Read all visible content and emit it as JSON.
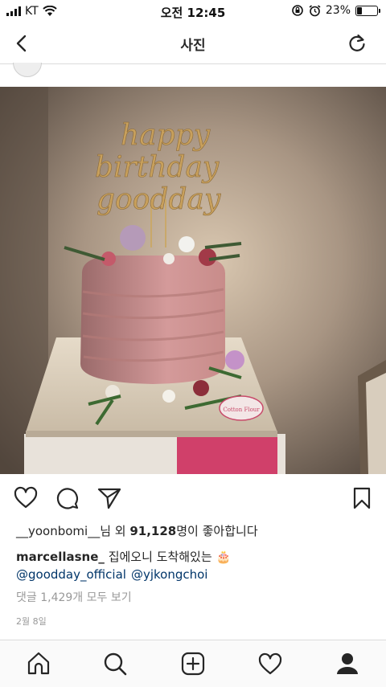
{
  "status_bar": {
    "carrier": "KT",
    "time": "오전 12:45",
    "battery_percent": "23%",
    "battery_level": 0.23
  },
  "nav": {
    "title": "사진",
    "back_icon": "chevron-left-icon",
    "refresh_icon": "refresh-icon"
  },
  "post": {
    "topper_line_1": "happy",
    "topper_line_2": "birthday",
    "topper_line_3": "goodday",
    "box_label": "Cotton Flour",
    "likes_user": "__yoonbomi__",
    "likes_prefix": "님 외 ",
    "likes_count": "91,128",
    "likes_suffix": "명이 좋아합니다",
    "caption_user": "marcellasne_",
    "caption_text": "집에오니 도착해있는",
    "caption_emoji": "🎂",
    "mention_1": "@goodday_official",
    "mention_2": "@yjkongchoi",
    "view_comments": "댓글 1,429개 모두 보기",
    "date": "2월 8일"
  },
  "icons": {
    "actions": [
      "heart-icon",
      "comment-icon",
      "share-icon",
      "bookmark-icon"
    ],
    "tabs": [
      "home-icon",
      "search-icon",
      "add-icon",
      "activity-icon",
      "profile-icon"
    ]
  },
  "colors": {
    "link": "#003569",
    "muted": "#999999",
    "text": "#262626",
    "border": "#dbdbdb"
  }
}
